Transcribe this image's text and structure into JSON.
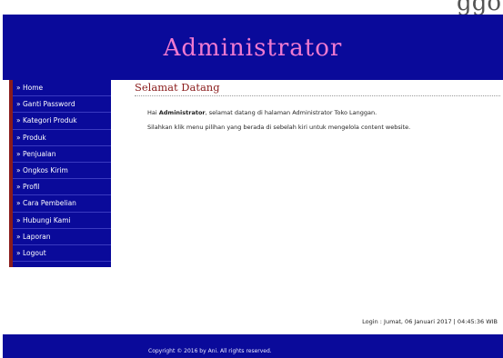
{
  "site_name_fragment": "ggo",
  "header": {
    "title": "Administrator"
  },
  "sidebar": {
    "items": [
      {
        "label": "» Home"
      },
      {
        "label": "» Ganti Password"
      },
      {
        "label": "» Kategori Produk"
      },
      {
        "label": "» Produk"
      },
      {
        "label": "» Penjualan"
      },
      {
        "label": "» Ongkos Kirim"
      },
      {
        "label": "» Profil"
      },
      {
        "label": "» Cara Pembelian"
      },
      {
        "label": "» Hubungi Kami"
      },
      {
        "label": "» Laporan"
      },
      {
        "label": "» Logout"
      }
    ]
  },
  "main": {
    "title": "Selamat Datang",
    "greeting_prefix": "Hai ",
    "greeting_name": "Administrator",
    "greeting_suffix": ", selamat datang di halaman Administrator Toko Langgan.",
    "instruction": "Silahkan klik menu pilihan yang berada di sebelah kiri untuk mengelola content website."
  },
  "status": {
    "login": "Login : Jumat, 06 Januari 2017 | 04:45:36 WIB"
  },
  "footer": {
    "copyright": "Copyright © 2016 by Ani. All rights reserved."
  },
  "colors": {
    "header_bg": "#0a0a9a",
    "title_color": "#f07ad0",
    "accent": "#8a1c1c"
  }
}
